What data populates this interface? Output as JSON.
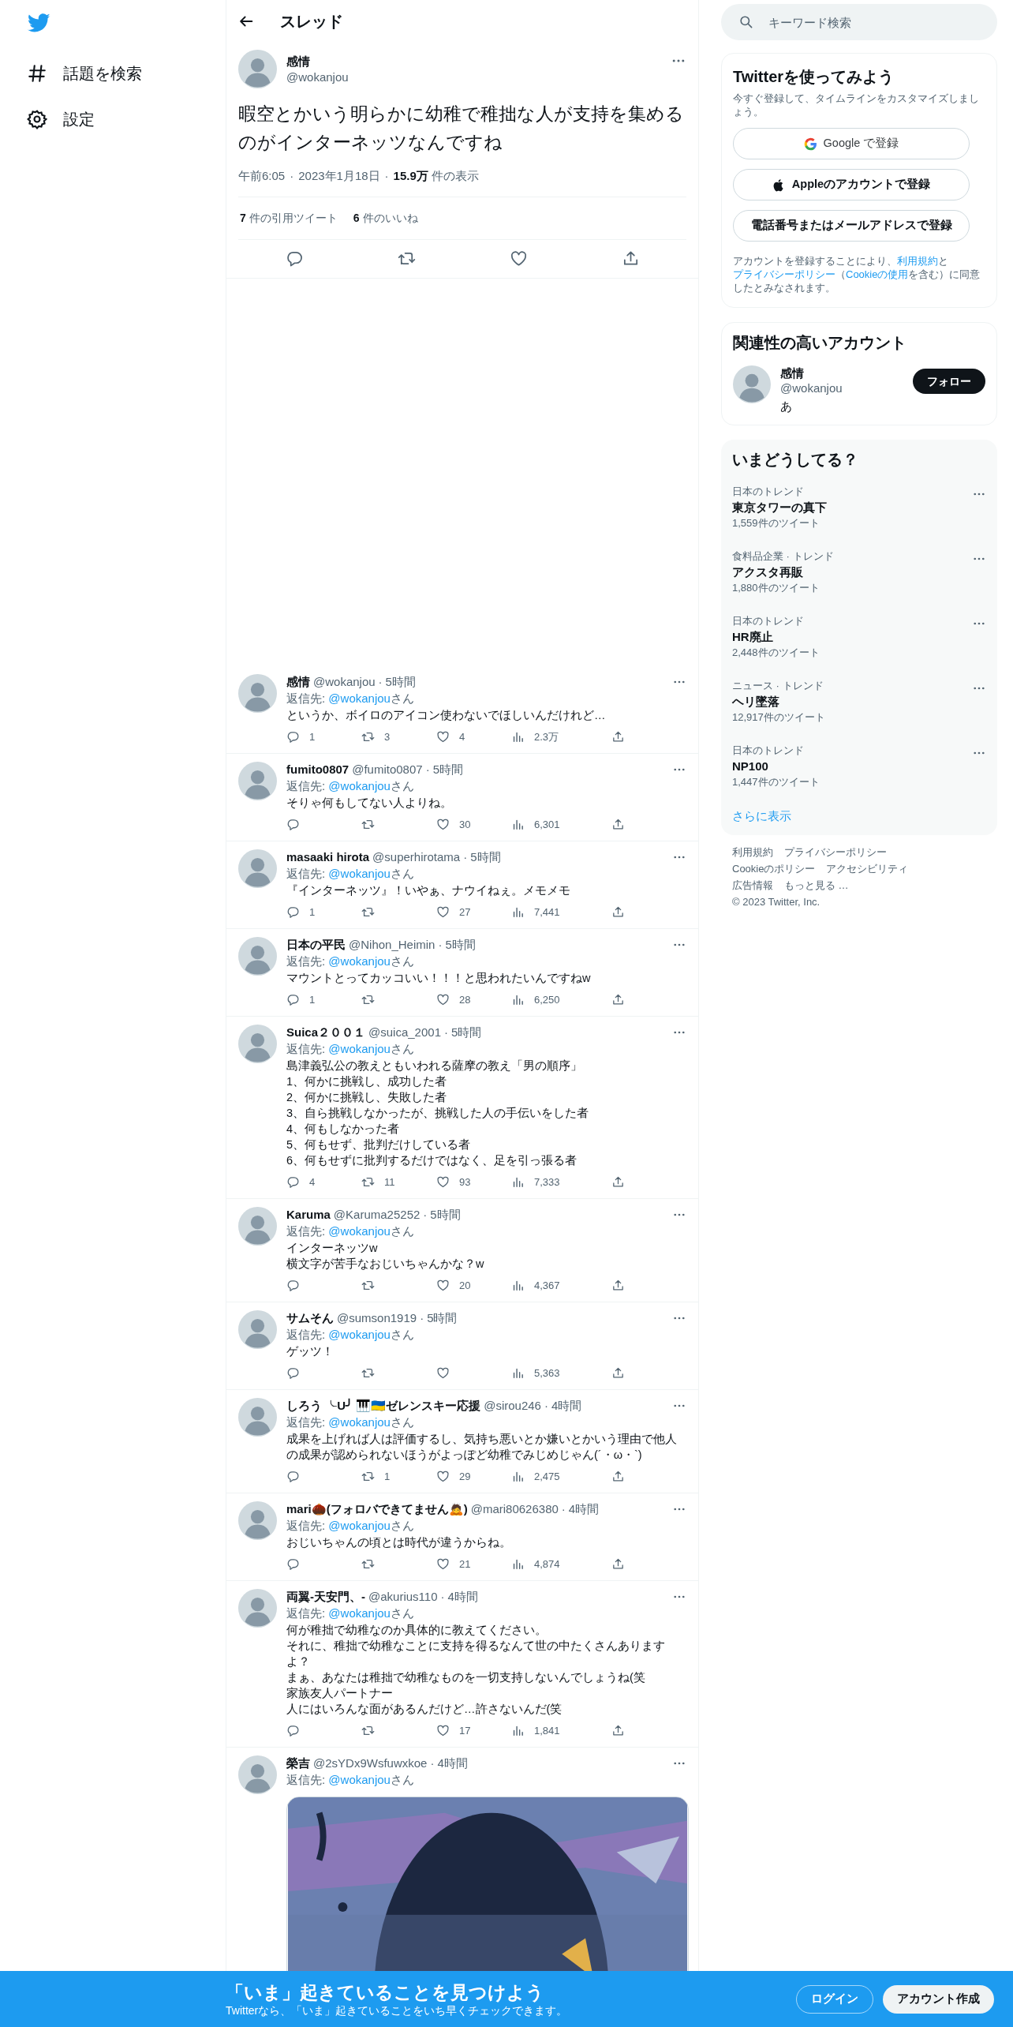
{
  "nav": {
    "items": [
      {
        "label": "話題を検索",
        "kind": "explore"
      },
      {
        "label": "設定",
        "kind": "settings"
      }
    ]
  },
  "header": {
    "title": "スレッド"
  },
  "main_tweet": {
    "name": "感情",
    "handle": "@wokanjou",
    "text": "暇空とかいう明らかに幼稚で稚拙な人が支持を集めるのがインターネッツなんですね",
    "time": "午前6:05",
    "separator": "·",
    "date": "2023年1月18日",
    "views_count": "15.9万",
    "views_label": "件の表示",
    "quotes_count": "7",
    "quotes_label": "件の引用ツイート",
    "likes_count": "6",
    "likes_label": "件のいいね"
  },
  "replies": [
    {
      "name": "感情",
      "handle": "@wokanjou",
      "separator": "·",
      "time": "5時間",
      "reply_prefix": "返信先: ",
      "reply_to": "@wokanjou",
      "reply_suffix": "さん",
      "lines": [
        "というか、ボイロのアイコン使わないでほしいんだけれど…"
      ],
      "replies": "1",
      "retweets": "3",
      "likes": "4",
      "views": "2.3万"
    },
    {
      "name": "fumito0807",
      "handle": "@fumito0807",
      "separator": "·",
      "time": "5時間",
      "reply_prefix": "返信先: ",
      "reply_to": "@wokanjou",
      "reply_suffix": "さん",
      "lines": [
        "そりゃ何もしてない人よりね。"
      ],
      "likes": "30",
      "views": "6,301"
    },
    {
      "name": "masaaki hirota",
      "handle": "@superhirotama",
      "separator": "·",
      "time": "5時間",
      "reply_prefix": "返信先: ",
      "reply_to": "@wokanjou",
      "reply_suffix": "さん",
      "lines": [
        "『インターネッツ』！いやぁ、ナウイねぇ。メモメモ"
      ],
      "replies": "1",
      "likes": "27",
      "views": "7,441"
    },
    {
      "name": "日本の平民",
      "handle": "@Nihon_Heimin",
      "separator": "·",
      "time": "5時間",
      "reply_prefix": "返信先: ",
      "reply_to": "@wokanjou",
      "reply_suffix": "さん",
      "lines": [
        "マウントとってカッコいい！！！と思われたいんですねw"
      ],
      "replies": "1",
      "likes": "28",
      "views": "6,250"
    },
    {
      "name": "Suica２００１",
      "handle": "@suica_2001",
      "separator": "·",
      "time": "5時間",
      "reply_prefix": "返信先: ",
      "reply_to": "@wokanjou",
      "reply_suffix": "さん",
      "lines": [
        "島津義弘公の教えともいわれる薩摩の教え「男の順序」",
        "1、何かに挑戦し、成功した者",
        "2、何かに挑戦し、失敗した者",
        "3、自ら挑戦しなかったが、挑戦した人の手伝いをした者",
        "4、何もしなかった者",
        "5、何もせず、批判だけしている者",
        "6、何もせずに批判するだけではなく、足を引っ張る者"
      ],
      "replies": "4",
      "retweets": "11",
      "likes": "93",
      "views": "7,333"
    },
    {
      "name": "Karuma",
      "handle": "@Karuma25252",
      "separator": "·",
      "time": "5時間",
      "reply_prefix": "返信先: ",
      "reply_to": "@wokanjou",
      "reply_suffix": "さん",
      "lines": [
        "インターネッツw",
        "横文字が苦手なおじいちゃんかな？w"
      ],
      "likes": "20",
      "views": "4,367"
    },
    {
      "name": "サムそん",
      "handle": "@sumson1919",
      "separator": "·",
      "time": "5時間",
      "reply_prefix": "返信先: ",
      "reply_to": "@wokanjou",
      "reply_suffix": "さん",
      "lines": [
        "ゲッツ！"
      ],
      "views": "5,363"
    },
    {
      "name": "しろう ╰U╯ 🎹🇺🇦ゼレンスキー応援",
      "handle": "@sirou246",
      "separator": "·",
      "time": "4時間",
      "reply_prefix": "返信先: ",
      "reply_to": "@wokanjou",
      "reply_suffix": "さん",
      "lines": [
        "成果を上げれば人は評価するし、気持ち悪いとか嫌いとかいう理由で他人の成果が認められないほうがよっぽど幼稚でみじめじゃん(´・ω・`)"
      ],
      "retweets": "1",
      "likes": "29",
      "views": "2,475"
    },
    {
      "name": "mari🌰(フォロバできてません🙇)",
      "handle": "@mari80626380",
      "separator": "·",
      "time": "4時間",
      "reply_prefix": "返信先: ",
      "reply_to": "@wokanjou",
      "reply_suffix": "さん",
      "lines": [
        "おじいちゃんの頃とは時代が違うからね。"
      ],
      "likes": "21",
      "views": "4,874"
    },
    {
      "name": "両翼-天安門、-",
      "handle": "@akurius110",
      "separator": "·",
      "time": "4時間",
      "reply_prefix": "返信先: ",
      "reply_to": "@wokanjou",
      "reply_suffix": "さん",
      "lines": [
        "何が稚拙で幼稚なのか具体的に教えてください。",
        "それに、稚拙で幼稚なことに支持を得るなんて世の中たくさんあります",
        "よ？",
        "まぁ、あなたは稚拙で幼稚なものを一切支持しないんでしょうね(笑",
        "家族友人パートナー",
        "人にはいろんな面があるんだけど…許さないんだ(笑"
      ],
      "likes": "17",
      "views": "1,841"
    },
    {
      "name": "榮吉",
      "handle": "@2sYDx9Wsfuwxkoe",
      "separator": "·",
      "time": "4時間",
      "reply_prefix": "返信先: ",
      "reply_to": "@wokanjou",
      "reply_suffix": "さん"
    }
  ],
  "sidebar": {
    "search": {
      "placeholder": "キーワード検索"
    },
    "signup": {
      "title": "Twitterを使ってみよう",
      "subtitle": "今すぐ登録して、タイムラインをカスタマイズしましょう。",
      "buttons": [
        {
          "label": "Google で登録",
          "kind": "google"
        },
        {
          "label": "Appleのアカウントで登録",
          "kind": "apple"
        },
        {
          "label": "電話番号またはメールアドレスで登録",
          "kind": "plain"
        }
      ],
      "legal": [
        {
          "text": "アカウントを登録することにより、",
          "kind": "plain"
        },
        {
          "text": "利用規約",
          "kind": "link"
        },
        {
          "text": "と",
          "kind": "plain"
        },
        {
          "text": "プライバシーポリシー",
          "kind": "link"
        },
        {
          "text": "（",
          "kind": "plain"
        },
        {
          "text": "Cookieの使用",
          "kind": "link"
        },
        {
          "text": "を含む）に同意したとみなされます。",
          "kind": "plain"
        }
      ]
    },
    "related": {
      "title": "関連性の高いアカウント",
      "accounts": [
        {
          "name": "感情",
          "handle": "@wokanjou",
          "bio": "あ",
          "button": "フォロー"
        }
      ]
    },
    "trends": {
      "title": "いまどうしてる？",
      "items": [
        {
          "context": "日本のトレンド",
          "title": "東京タワーの真下",
          "count": "1,559件のツイート"
        },
        {
          "context": "食料品企業 · トレンド",
          "title": "アクスタ再販",
          "count": "1,880件のツイート"
        },
        {
          "context": "日本のトレンド",
          "title": "HR廃止",
          "count": "2,448件のツイート"
        },
        {
          "context": "ニュース · トレンド",
          "title": "ヘリ墜落",
          "count": "12,917件のツイート"
        },
        {
          "context": "日本のトレンド",
          "title": "NP100",
          "count": "1,447件のツイート"
        }
      ],
      "more": "さらに表示"
    },
    "footer": {
      "links": [
        "利用規約",
        "プライバシーポリシー",
        "Cookieのポリシー",
        "アクセシビリティ",
        "広告情報",
        "もっと見る …"
      ],
      "copyright": "© 2023 Twitter, Inc."
    }
  },
  "bottom_bar": {
    "title": "「いま」起きていることを見つけよう",
    "subtitle": "Twitterなら、「いま」起きていることをいち早くチェックできます。",
    "login": "ログイン",
    "signup": "アカウント作成"
  }
}
